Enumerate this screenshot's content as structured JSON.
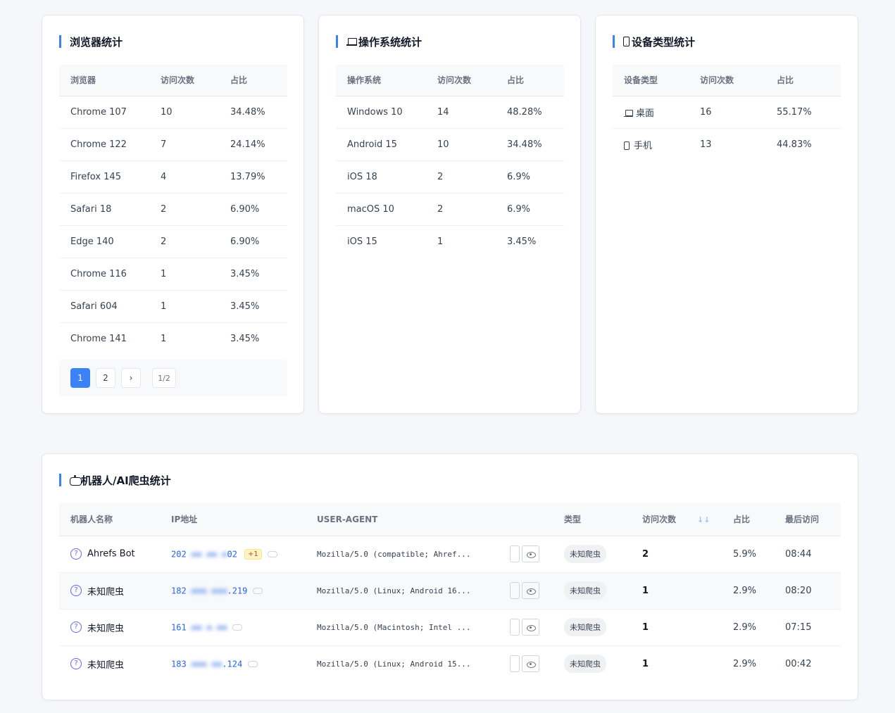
{
  "browser_card": {
    "title": "浏览器统计",
    "headers": [
      "浏览器",
      "访问次数",
      "占比"
    ],
    "rows": [
      [
        "Chrome 107",
        "10",
        "34.48%"
      ],
      [
        "Chrome 122",
        "7",
        "24.14%"
      ],
      [
        "Firefox 145",
        "4",
        "13.79%"
      ],
      [
        "Safari 18",
        "2",
        "6.90%"
      ],
      [
        "Edge 140",
        "2",
        "6.90%"
      ],
      [
        "Chrome 116",
        "1",
        "3.45%"
      ],
      [
        "Safari 604",
        "1",
        "3.45%"
      ],
      [
        "Chrome 141",
        "1",
        "3.45%"
      ]
    ],
    "pager": {
      "page1": "1",
      "page2": "2",
      "next": "›",
      "info": "1/2"
    }
  },
  "os_card": {
    "title": "操作系统统计",
    "icon": "laptop-icon",
    "headers": [
      "操作系统",
      "访问次数",
      "占比"
    ],
    "rows": [
      [
        "Windows 10",
        "14",
        "48.28%"
      ],
      [
        "Android 15",
        "10",
        "34.48%"
      ],
      [
        "iOS 18",
        "2",
        "6.9%"
      ],
      [
        "macOS 10",
        "2",
        "6.9%"
      ],
      [
        "iOS 15",
        "1",
        "3.45%"
      ]
    ]
  },
  "device_card": {
    "title": "设备类型统计",
    "icon": "phone-icon",
    "headers": [
      "设备类型",
      "访问次数",
      "占比"
    ],
    "rows": [
      {
        "icon": "laptop-icon",
        "type": "桌面",
        "count": "16",
        "pct": "55.17%"
      },
      {
        "icon": "phone-icon",
        "type": "手机",
        "count": "13",
        "pct": "44.83%"
      }
    ]
  },
  "bot_card": {
    "title": "机器人/AI爬虫统计",
    "icon": "robot-icon",
    "headers": [
      "机器人名称",
      "IP地址",
      "USER-AGENT",
      "类型",
      "访问次数",
      "占比",
      "最后访问"
    ],
    "sort_icon": "↓↓",
    "rows": [
      {
        "name": "Ahrefs Bot",
        "ip_prefix": "202",
        "ip_blur": ".●●.●●.●",
        "ip_suffix": "02",
        "extra": "+1",
        "ua": "Mozilla/5.0 (compatible; Ahref...",
        "type": "未知爬虫",
        "count": "2",
        "pct": "5.9%",
        "last": "08:44"
      },
      {
        "name": "未知爬虫",
        "ip_prefix": "182",
        "ip_blur": ".●●●.●●●",
        "ip_suffix": ".219",
        "extra": "",
        "ua": "Mozilla/5.0 (Linux; Android 16...",
        "type": "未知爬虫",
        "count": "1",
        "pct": "2.9%",
        "last": "08:20"
      },
      {
        "name": "未知爬虫",
        "ip_prefix": "161",
        "ip_blur": ".●●.●.●●",
        "ip_suffix": "",
        "extra": "",
        "ua": "Mozilla/5.0 (Macintosh; Intel ...",
        "type": "未知爬虫",
        "count": "1",
        "pct": "2.9%",
        "last": "07:15"
      },
      {
        "name": "未知爬虫",
        "ip_prefix": "183",
        "ip_blur": ".●●●.●●",
        "ip_suffix": ".124",
        "extra": "",
        "ua": "Mozilla/5.0 (Linux; Android 15...",
        "type": "未知爬虫",
        "count": "1",
        "pct": "2.9%",
        "last": "00:42"
      }
    ]
  }
}
